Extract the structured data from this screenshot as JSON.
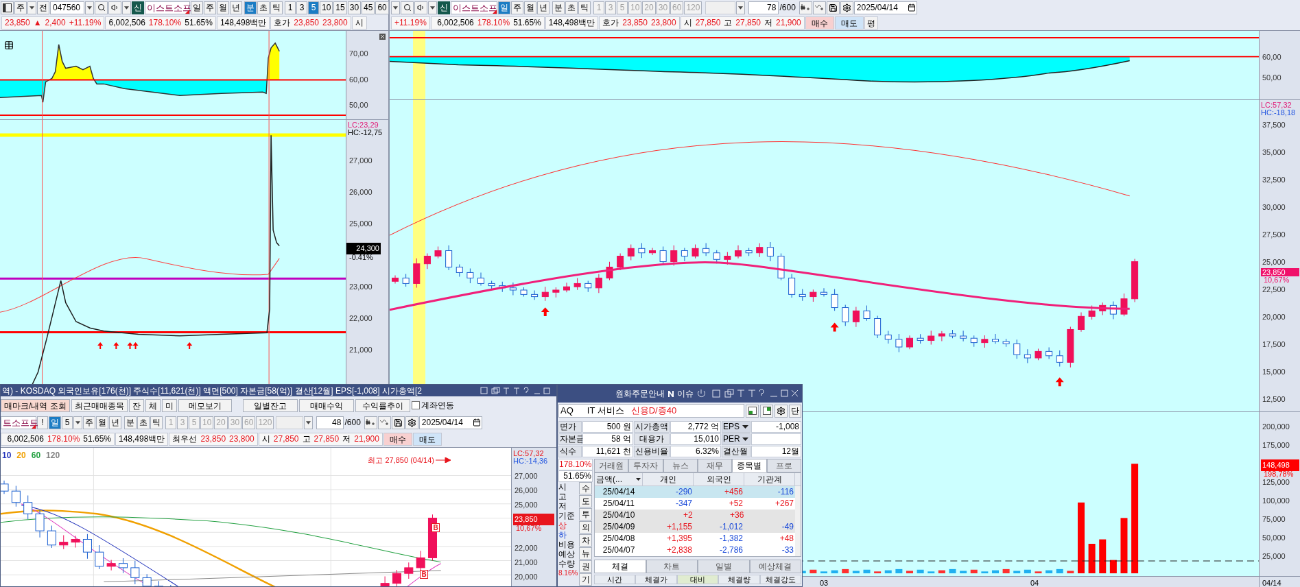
{
  "left_pane": {
    "toolbar": {
      "market": "주",
      "prev_button": "전",
      "code": "047560",
      "credit_badge": "신",
      "stock_name": "이스트소프",
      "periods": [
        {
          "label": "일",
          "selected": false
        },
        {
          "label": "주",
          "selected": false
        },
        {
          "label": "월",
          "selected": false
        },
        {
          "label": "년",
          "selected": false
        },
        {
          "label": "분",
          "selected": true
        },
        {
          "label": "초",
          "selected": false
        },
        {
          "label": "틱",
          "selected": false
        }
      ],
      "intervals": [
        {
          "label": "1",
          "selected": false
        },
        {
          "label": "3",
          "selected": false
        },
        {
          "label": "5",
          "selected": true
        },
        {
          "label": "10",
          "selected": false
        },
        {
          "label": "15",
          "selected": false
        },
        {
          "label": "30",
          "selected": false
        },
        {
          "label": "45",
          "selected": false
        },
        {
          "label": "60",
          "selected": false
        }
      ]
    },
    "quote": {
      "price": "23,850",
      "arrow": "▲",
      "change": "2,400",
      "rate": "+11.19%",
      "volume": "6,002,506",
      "ratio_1": "178.10%",
      "ratio_2": "51.65%",
      "amount": "148,498백만",
      "hoga_label": "호가",
      "ask": "23,850",
      "bid": "23,800",
      "open_label": "시"
    },
    "indicator_ticks": [
      "70,00",
      "60,00",
      "50,00"
    ],
    "price_chart": {
      "lc": "LC:23,29",
      "hc": "HC:-12,75",
      "ticks": [
        "27,000",
        "26,000",
        "25,000",
        "23,000",
        "22,000",
        "21,000"
      ],
      "current_price": "24,300",
      "current_rate": "-0.41%"
    }
  },
  "right_pane": {
    "toolbar": {
      "credit_badge": "신",
      "stock_name": "이스트소프",
      "periods": [
        {
          "label": "일",
          "selected": true
        },
        {
          "label": "주",
          "selected": false
        },
        {
          "label": "월",
          "selected": false
        },
        {
          "label": "년",
          "selected": false
        },
        {
          "label": "분",
          "selected": false
        },
        {
          "label": "초",
          "selected": false
        },
        {
          "label": "틱",
          "selected": false
        }
      ],
      "intervals": [
        "1",
        "3",
        "5",
        "10",
        "20",
        "30",
        "60",
        "120"
      ],
      "intervals_disabled": true,
      "count": "78",
      "count_max": "/600",
      "date": "2025/04/14"
    },
    "quote": {
      "rate": "+11.19%",
      "volume": "6,002,506",
      "ratio_1": "178.10%",
      "ratio_2": "51.65%",
      "amount": "148,498백만",
      "hoga_label": "호가",
      "ask": "23,850",
      "bid": "23,800",
      "open_label": "시",
      "open": "27,850",
      "high_label": "고",
      "high": "27,850",
      "low_label": "저",
      "low": "21,900",
      "buy": "매수",
      "sell": "매도",
      "extra": "평"
    },
    "indicator_ticks": [
      "60,00",
      "50,00"
    ],
    "lc": "LC:57,32",
    "hc": "HC:-18,18",
    "price_ticks": [
      "37,500",
      "35,000",
      "32,500",
      "30,000",
      "27,500",
      "25,000",
      "22,500",
      "20,000",
      "17,500",
      "15,000",
      "12,500"
    ],
    "current_price": "23,850",
    "current_rate": "10,67%",
    "volume_ticks": [
      "200,000",
      "175,000",
      "125,000",
      "100,000",
      "75,000",
      "50,000",
      "25,000"
    ],
    "current_volume": "148,498",
    "volume_rate": "198,78%",
    "x_labels": [
      "03",
      "04"
    ],
    "date_label": "04/14"
  },
  "daily_window": {
    "title": "역) - KOSDAQ 외국인보유[176(천)] 주식수[11,621(천)] 액면[500] 자본금[58(억)] 결산[12월] EPS[-1,008] 시가총액[2",
    "buttons": [
      "매마크/내역 조회",
      "최근매매종목",
      "잔",
      "체",
      "미",
      "메모보기",
      "일별잔고",
      "매매수익",
      "수익률추이"
    ],
    "account_link": {
      "label": "계좌연동",
      "checked": false
    },
    "toolbar": {
      "stock_name": "트소프트",
      "alert": "!",
      "interval_select": "5",
      "periods": [
        {
          "label": "일",
          "selected": true
        },
        {
          "label": "주",
          "selected": false
        },
        {
          "label": "월",
          "selected": false
        },
        {
          "label": "년",
          "selected": false
        },
        {
          "label": "분",
          "selected": false
        },
        {
          "label": "초",
          "selected": false
        },
        {
          "label": "틱",
          "selected": false
        }
      ],
      "intervals": [
        "1",
        "3",
        "5",
        "10",
        "20",
        "30",
        "60",
        "120"
      ],
      "intervals_disabled": true,
      "count": "48",
      "count_max": "/600",
      "date": "2025/04/14"
    },
    "quote": {
      "volume": "6,002,506",
      "ratio_1": "178.10%",
      "ratio_2": "51.65%",
      "amount": "148,498백만",
      "best_label": "최우선",
      "ask": "23,850",
      "bid": "23,800",
      "open_label": "시",
      "open": "27,850",
      "high_label": "고",
      "high": "27,850",
      "low_label": "저",
      "low": "21,900",
      "buy": "매수",
      "sell": "매도"
    },
    "chart": {
      "ma_legend": [
        {
          "label": "10",
          "color": "#2233bb"
        },
        {
          "label": "20",
          "color": "#f0a000"
        },
        {
          "label": "60",
          "color": "#22a040"
        },
        {
          "label": "120",
          "color": "#808080"
        }
      ],
      "high_note": "최고 27,850 (04/14)",
      "lc": "LC:57,32",
      "hc": "HC:-14,36",
      "ticks": [
        "27,000",
        "26,000",
        "25,000",
        "22,000",
        "21,000",
        "20,000"
      ],
      "current_price": "23,850",
      "current_rate": "10,67%",
      "buy_markers": [
        "B",
        "B"
      ]
    }
  },
  "info_window": {
    "title": "원화주문안내",
    "issue_label": "이슈",
    "market": "AQ",
    "sector": "IT 서비스",
    "credit": "신용D/증40",
    "unit_button": "단",
    "grid": [
      {
        "label": "면가",
        "value": "500 원",
        "label2": "시가총액",
        "value2": "2,772 억",
        "label3": "EPS",
        "dropdown": true,
        "value3": "-1,008"
      },
      {
        "label": "자본금",
        "value": "58 억",
        "label2": "대용가",
        "value2": "15,010",
        "label3": "PER",
        "dropdown": true
      },
      {
        "label": "식수",
        "value": "11,621 천",
        "label2": "신용비율",
        "value2": "6.32%",
        "label3": "결산월",
        "value3": "12월"
      }
    ],
    "side_values": [
      "178.10%",
      "51.65%"
    ],
    "side_labels": [
      {
        "text": "시",
        "kind": "plain"
      },
      {
        "text": "고",
        "kind": "plain"
      },
      {
        "text": "저",
        "kind": "plain"
      },
      {
        "text": "기준",
        "kind": "plain"
      },
      {
        "text": "상",
        "kind": "up"
      },
      {
        "text": "하",
        "kind": "down"
      },
      {
        "text": "비용",
        "kind": "plain"
      },
      {
        "text": "예상",
        "kind": "plain"
      },
      {
        "text": "수량",
        "kind": "plain"
      }
    ],
    "side_footer": "8.16%",
    "side_buttons": [
      "수",
      "도",
      "투",
      "외",
      "차",
      "뉴",
      "권",
      "기"
    ],
    "tabs": [
      {
        "label": "거래원",
        "selected": false
      },
      {
        "label": "투자자",
        "selected": false
      },
      {
        "label": "뉴스",
        "selected": false
      },
      {
        "label": "재무",
        "selected": false
      },
      {
        "label": "종목별",
        "selected": true
      },
      {
        "label": "프로",
        "selected": false
      }
    ],
    "table": {
      "columns": [
        "금액(...",
        "개인",
        "외국인",
        "기관계"
      ],
      "rows": [
        {
          "date": "25/04/14",
          "selected": true,
          "cells": [
            {
              "text": "-290",
              "rising": false
            },
            {
              "text": "+456",
              "rising": true
            },
            {
              "text": "-116",
              "rising": false
            }
          ]
        },
        {
          "date": "25/04/11",
          "selected": false,
          "cells": [
            {
              "text": "-347",
              "rising": false
            },
            {
              "text": "+52",
              "rising": true
            },
            {
              "text": "+267",
              "rising": true
            }
          ]
        },
        {
          "date": "25/04/10",
          "selected": false,
          "shaded": true,
          "cells": [
            {
              "text": "+2",
              "rising": true
            },
            {
              "text": "+36",
              "rising": true
            }
          ]
        },
        {
          "date": "25/04/09",
          "selected": false,
          "shaded": true,
          "cells": [
            {
              "text": "+1,155",
              "rising": true
            },
            {
              "text": "-1,012",
              "rising": false
            },
            {
              "text": "-49",
              "rising": false
            }
          ]
        },
        {
          "date": "25/04/08",
          "selected": false,
          "cells": [
            {
              "text": "+1,395",
              "rising": true
            },
            {
              "text": "-1,382",
              "rising": false
            },
            {
              "text": "+48",
              "rising": true
            }
          ]
        },
        {
          "date": "25/04/07",
          "selected": false,
          "cells": [
            {
              "text": "+2,838",
              "rising": true
            },
            {
              "text": "-2,786",
              "rising": false
            },
            {
              "text": "-33",
              "rising": false
            }
          ]
        }
      ]
    },
    "bottom_tabs": [
      {
        "label": "체결",
        "selected": true
      },
      {
        "label": "차트",
        "selected": false
      },
      {
        "label": "일별",
        "selected": false
      },
      {
        "label": "예상체결",
        "selected": false
      }
    ],
    "trade_columns": [
      "시간",
      "체결가",
      "대비",
      "체결량",
      "체결강도"
    ]
  }
}
